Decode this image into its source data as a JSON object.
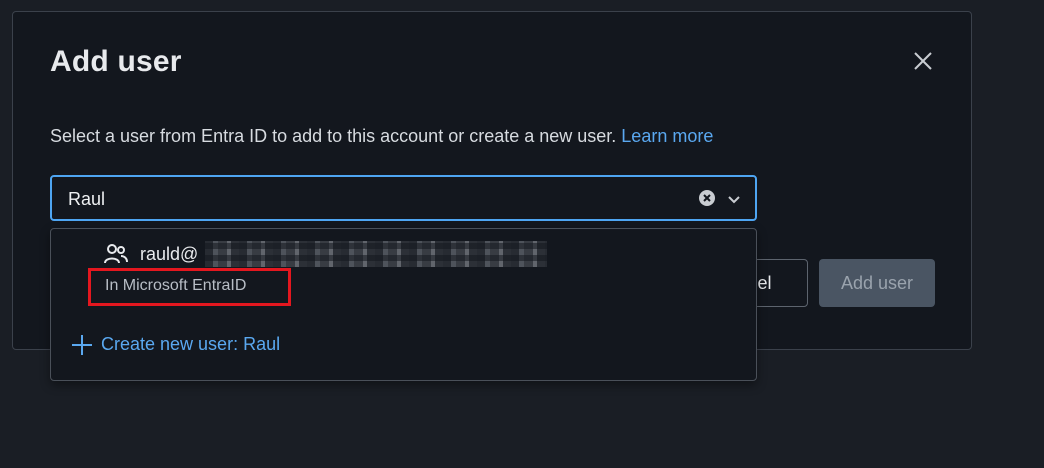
{
  "dialog": {
    "title": "Add user",
    "description": "Select a user from Entra ID to add to this account or create a new user.",
    "learn_more_link": "Learn more",
    "cancel_label": "Cancel",
    "add_user_label": "Add user"
  },
  "search": {
    "value": "Raul"
  },
  "dropdown": {
    "user_option": {
      "email_visible": "rauld@",
      "source_label": "In Microsoft EntraID"
    },
    "create_option": {
      "label": "Create new user: Raul"
    }
  },
  "icons": {
    "close": "close-icon",
    "clear": "clear-circle-icon",
    "chevron": "chevron-down-icon",
    "person": "people-icon",
    "plus": "plus-icon"
  },
  "colors": {
    "accent": "#4ea5f2",
    "link": "#5aa8f0",
    "highlight": "#e4171f",
    "dialog_bg": "#13171e"
  }
}
